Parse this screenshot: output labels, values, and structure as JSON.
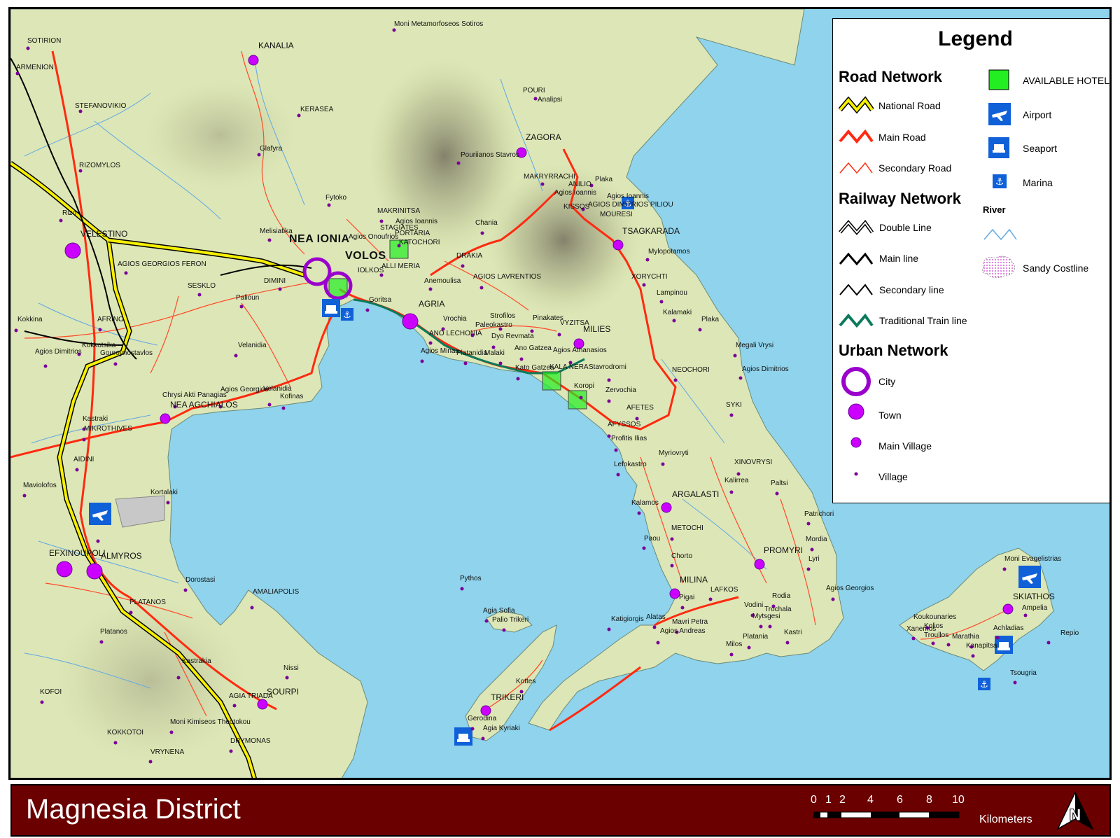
{
  "map": {
    "cities": [
      "NEA IONIA",
      "VOLOS"
    ],
    "towns": [
      "KANALIA",
      "ZAGORA",
      "TSAGKARADA",
      "MILIES",
      "AGRIA",
      "VELESTINO",
      "NEA AGCHIALOS",
      "EFXINOUPOLI",
      "ALMYROS",
      "ARGALASTI",
      "PROMYRI",
      "MILINA",
      "TRIKERI",
      "SKIATHOS",
      "SOURPI"
    ],
    "villages": [
      "SOTIRION",
      "ARMENION",
      "STEFANOVIKIO",
      "RIZOMYLOS",
      "Glafyra",
      "KERASEA",
      "Moni Metamorfoseos Sotiros",
      "POURI",
      "Analipsi",
      "Pouriianos Stavros",
      "MAKRYRRACHI",
      "ANILIO",
      "Plaka",
      "Agios Ioannis",
      "Agios Ioannis",
      "KISSOS",
      "AGIOS DIMITRIOS PILIOU",
      "MOURESI",
      "Fytoko",
      "MAKRINITSA",
      "STAGIATES",
      "PORTARIA",
      "KATOCHORI",
      "Agios Ioannis",
      "Agios Onoufrios",
      "Chania",
      "Rizo",
      "Melisiatika",
      "AGIOS GEORGIOS FERON",
      "SESKLO",
      "DIMINI",
      "ALLI MERIA",
      "IOLKOS",
      "DRAKIA",
      "Anemoulisa",
      "AGIOS LAVRENTIOS",
      "Mylopotamos",
      "XORYCHTI",
      "Lampinou",
      "Kalamaki",
      "Plaka",
      "Megali Vrysi",
      "Agios Dimitrios",
      "NEOCHORI",
      "Palioun",
      "Kokkina",
      "AFRINO",
      "Agios Dimitrios",
      "Kokkotsika",
      "Gouroynostavlos",
      "Velanidia",
      "Chrysi Akti Panagias",
      "Agios Georgios",
      "Velanidia",
      "Kofinas",
      "Kastraki",
      "MIKROTHIVES",
      "AIDINI",
      "Maviolofos",
      "Kortalaki",
      "PLATANOS",
      "Platanos",
      "Dorostasi",
      "AMALIAPOLIS",
      "Kastrakia",
      "Nissi",
      "KOFOI",
      "AGIA TRIADA",
      "Moni Kimiseos Theotokou",
      "KOKKOTOI",
      "DRYMONAS",
      "VRYNENA",
      "Goritsa",
      "ANO LECHONIA",
      "Vrochia",
      "Agios Minas",
      "Platanidia",
      "Malaki",
      "Strofilos",
      "Paleokastro",
      "Dyo Revmata",
      "Pinakates",
      "VYZITSA",
      "Ano Gatzea",
      "Agios Athanasios",
      "Kato Gatzea",
      "KALA NERA",
      "Stavrodromi",
      "Koropi",
      "Zervochia",
      "AFETES",
      "AFYSSOS",
      "Profitis Ilias",
      "SYKI",
      "Myriovryti",
      "XINOVRYSI",
      "Lefokastro",
      "Kalirrea",
      "Paltsi",
      "Kalamos",
      "METOCHI",
      "Patrichori",
      "Paou",
      "Mordia",
      "Chorto",
      "Lyri",
      "Agios Georgios",
      "LAFKOS",
      "Rodia",
      "Pigai",
      "Vodini",
      "Trochala",
      "Mavri Petra",
      "Agios Andreas",
      "Platania",
      "Mytsgesi",
      "Kastri",
      "Milos",
      "Katigiorgis",
      "Alatas",
      "Pythos",
      "Agia Sofia",
      "Palio Trikeri",
      "Kottes",
      "Gerodina",
      "Agia Kyriaki",
      "Moni Evagelistrias",
      "Koukounaries",
      "Xanemos",
      "Kolios",
      "Troullos",
      "Marathia",
      "Kanapitsa",
      "Achladias",
      "Tsougria",
      "Repio",
      "Ampelia"
    ]
  },
  "legend": {
    "title": "Legend",
    "road_network": {
      "heading": "Road Network",
      "items": [
        "National Road",
        "Main Road",
        "Secondary Road"
      ]
    },
    "railway_network": {
      "heading": "Railway Network",
      "items": [
        "Double Line",
        "Main line",
        "Secondary line",
        "Traditional Train line"
      ]
    },
    "urban_network": {
      "heading": "Urban Network",
      "items": [
        "City",
        "Town",
        "Main Village",
        "Village"
      ]
    },
    "other": {
      "hotels": "AVAILABLE HOTELS",
      "airport": "Airport",
      "seaport": "Seaport",
      "marina": "Marina",
      "river_heading": "River",
      "sandy": "Sandy Costline"
    }
  },
  "footer": {
    "title": "Magnesia District",
    "scale": {
      "ticks": [
        "0",
        "1",
        "2",
        "4",
        "6",
        "8",
        "10"
      ],
      "unit": "Kilometers"
    }
  },
  "colors": {
    "sea": "#8fd3ec",
    "land": "#dfe7b8",
    "national_road": "#f6f000",
    "main_road": "#ff2a10",
    "river": "#5ea8e6",
    "city": "#9900cc",
    "town": "#cc00ff",
    "title_bar": "#6b0000",
    "hotel": "#22ee22"
  }
}
